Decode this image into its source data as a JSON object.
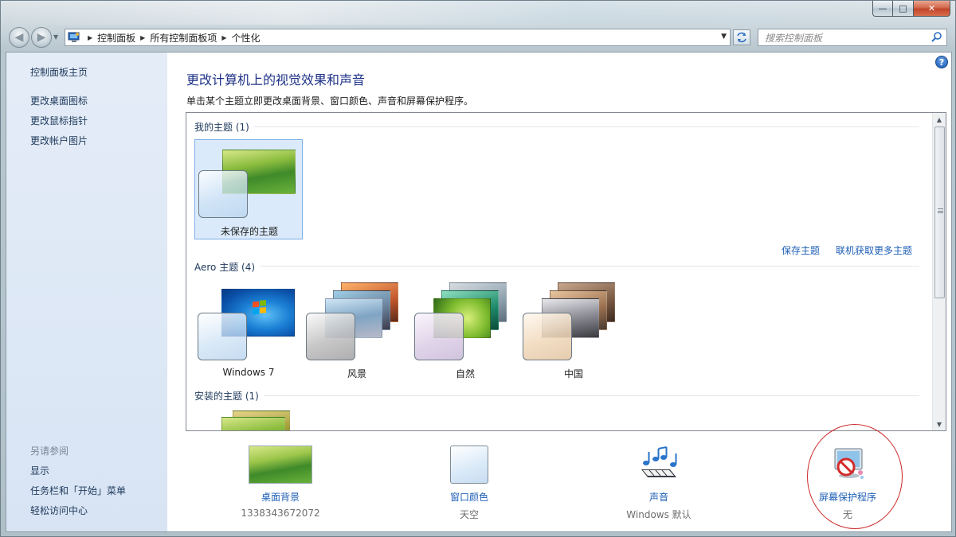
{
  "window": {
    "controls": {
      "minimize": "—",
      "maximize": "□",
      "close": "✕"
    }
  },
  "navbar": {
    "back_icon": "◀",
    "forward_icon": "▶",
    "breadcrumb": [
      "控制面板",
      "所有控制面板项",
      "个性化"
    ],
    "search_placeholder": "搜索控制面板"
  },
  "sidebar": {
    "links": [
      "控制面板主页",
      "更改桌面图标",
      "更改鼠标指针",
      "更改帐户图片"
    ],
    "see_also_header": "另请参阅",
    "see_also": [
      "显示",
      "任务栏和「开始」菜单",
      "轻松访问中心"
    ]
  },
  "main": {
    "help_icon": "?",
    "title": "更改计算机上的视觉效果和声音",
    "subtitle": "单击某个主题立即更改桌面背景、窗口颜色、声音和屏幕保护程序。",
    "groups": {
      "my_themes": {
        "label": "我的主题 (1)",
        "themes": [
          {
            "name": "未保存的主题"
          }
        ],
        "links": [
          "保存主题",
          "联机获取更多主题"
        ]
      },
      "aero_themes": {
        "label": "Aero 主题 (4)",
        "themes": [
          {
            "name": "Windows 7"
          },
          {
            "name": "风景"
          },
          {
            "name": "自然"
          },
          {
            "name": "中国"
          }
        ]
      },
      "installed_themes": {
        "label": "安装的主题 (1)"
      }
    }
  },
  "settings": [
    {
      "label": "桌面背景",
      "value": "1338343672072"
    },
    {
      "label": "窗口颜色",
      "value": "天空"
    },
    {
      "label": "声音",
      "value": "Windows 默认"
    },
    {
      "label": "屏幕保护程序",
      "value": "无"
    }
  ]
}
